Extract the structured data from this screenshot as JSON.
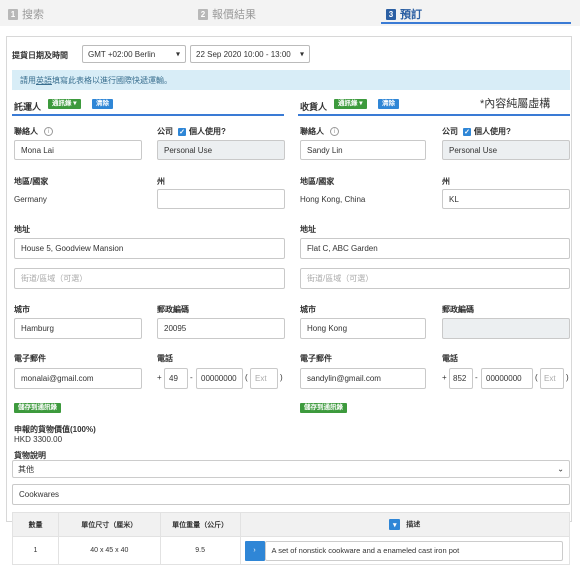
{
  "steps": [
    {
      "num": "1",
      "label": "搜索"
    },
    {
      "num": "2",
      "label": "報價結果"
    },
    {
      "num": "3",
      "label": "預訂"
    }
  ],
  "pickup": {
    "label": "提貨日期及時間",
    "timezone": "GMT +02:00 Berlin",
    "datetime": "22 Sep 2020 10:00 - 13:00"
  },
  "info_banner": {
    "prefix": "請用",
    "link": "英語",
    "suffix": "填寫此表格以進行國際快遞運輸。"
  },
  "note": "*內容純屬虛構",
  "common": {
    "contact_label": "聯絡人",
    "company_label": "公司",
    "personal_use_q": "個人使用?",
    "region_label": "地區/國家",
    "state_label": "州",
    "address_label": "地址",
    "street_placeholder": "街道/區域（可選）",
    "city_label": "城市",
    "postcode_label": "郵政編碼",
    "email_label": "電子郵件",
    "phone_label": "電話",
    "phone_plus": "+",
    "phone_dash": "-",
    "ext_placeholder": "Ext",
    "ext_paren_open": "(",
    "ext_paren_close": ")",
    "save_book_label": "儲存到通訊錄",
    "address_book_btn": "通訊錄",
    "clear_btn": "清除"
  },
  "sender": {
    "title": "託運人",
    "contact": "Mona Lai",
    "company": "Personal Use",
    "region": "Germany",
    "state": "",
    "address": "House 5, Goodview Mansion",
    "city": "Hamburg",
    "postcode": "20095",
    "email": "monalai@gmail.com",
    "phone_cc": "49",
    "phone": "00000000"
  },
  "recipient": {
    "title": "收貨人",
    "contact": "Sandy Lin",
    "company": "Personal Use",
    "region": "Hong Kong, China",
    "state": "KL",
    "address": "Flat C, ABC Garden",
    "city": "Hong Kong",
    "postcode": "",
    "email": "sandylin@gmail.com",
    "phone_cc": "852",
    "phone": "00000000"
  },
  "declared": {
    "label": "申報的貨物價值(100%)",
    "value": "HKD 3300.00"
  },
  "goods": {
    "label": "貨物說明",
    "category": "其他",
    "description": "Cookwares"
  },
  "items_table": {
    "headers": {
      "qty": "數量",
      "dims": "單位尺寸（厘米）",
      "weight": "單位重量（公斤）",
      "desc": "描述"
    },
    "rows": [
      {
        "qty": "1",
        "dims": "40 x 45 x 40",
        "weight": "9.5",
        "desc": "A set of nonstick cookware and a enameled cast iron pot"
      }
    ]
  }
}
